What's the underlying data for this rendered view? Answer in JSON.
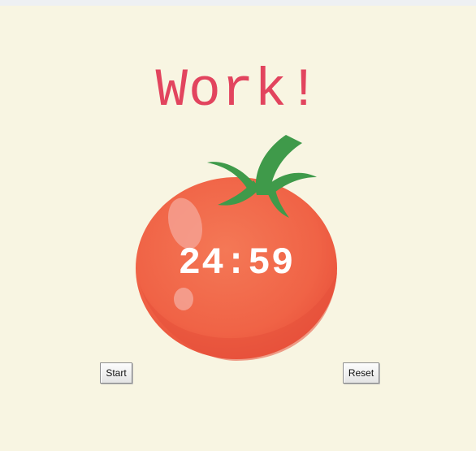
{
  "app": {
    "title_text": "Work!",
    "title_color": "#e2445e",
    "background_color": "#f8f5e2"
  },
  "timer": {
    "display": "24:59",
    "image_icon": "tomato-icon"
  },
  "controls": {
    "start_label": "Start",
    "reset_label": "Reset"
  }
}
